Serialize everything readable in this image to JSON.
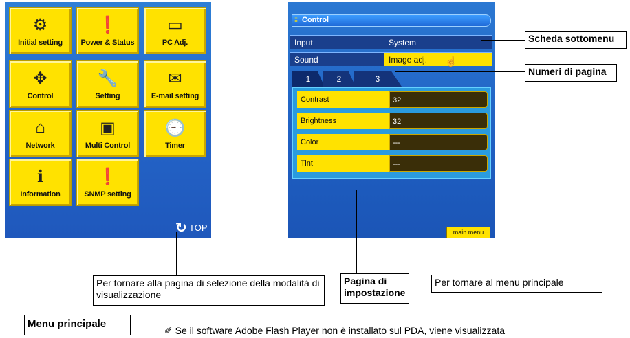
{
  "left_menu": {
    "tiles": [
      {
        "label": "Initial setting",
        "icon": "projector-gear-icon"
      },
      {
        "label": "Power & Status",
        "icon": "projector-exclamation-icon"
      },
      {
        "label": "PC Adj.",
        "icon": "monitor-projector-icon"
      },
      {
        "label": "Control",
        "icon": "four-arrows-icon"
      },
      {
        "label": "Setting",
        "icon": "wrench-icon"
      },
      {
        "label": "E-mail setting",
        "icon": "envelope-icon"
      },
      {
        "label": "Network",
        "icon": "network-projector-icon"
      },
      {
        "label": "Multi Control",
        "icon": "multi-projector-icon"
      },
      {
        "label": "Timer",
        "icon": "clock-icon"
      },
      {
        "label": "Information",
        "icon": "info-projector-icon"
      },
      {
        "label": "SNMP setting",
        "icon": "snmp-icon"
      }
    ],
    "top_label": "TOP"
  },
  "control_panel": {
    "header": "Control",
    "submenu_tabs": [
      "Input",
      "System",
      "Sound",
      "Image adj."
    ],
    "page_tabs": [
      "1",
      "2",
      "3"
    ],
    "rows": [
      {
        "label": "Contrast",
        "value": "32"
      },
      {
        "label": "Brightness",
        "value": "32"
      },
      {
        "label": "Color",
        "value": "---"
      },
      {
        "label": "Tint",
        "value": "---"
      }
    ],
    "main_menu_label": "main menu"
  },
  "callouts": {
    "submenu_tab": "Scheda sottomenu",
    "page_numbers": "Numeri di pagina",
    "back_to_mode": "Per tornare alla pagina di selezione della modalità di visualizzazione",
    "settings_page": "Pagina di impostazione",
    "back_to_main": "Per tornare al menu principale",
    "main_menu": "Menu principale"
  },
  "note": "Se il software Adobe Flash Player non è installato sul PDA, viene visualizzata"
}
